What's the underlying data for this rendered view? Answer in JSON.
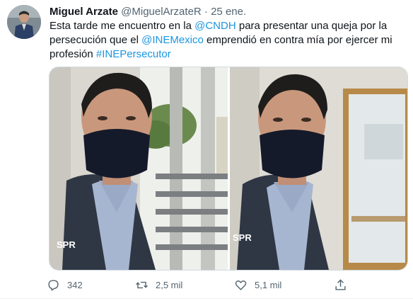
{
  "tweet": {
    "author_name": "Miguel Arzate",
    "author_handle": "@MiguelArzateR",
    "separator": "·",
    "date": "25 ene.",
    "text": {
      "part1": "Esta tarde me encuentro en la ",
      "mention1": "@CNDH",
      "part2": " para presentar una queja por la persecución que el ",
      "mention2": "@INEMexico",
      "part3": " emprendió en contra mía por ejercer mi profesión ",
      "hashtag": "#INEPersecutor"
    },
    "media": {
      "left_badge": "SPR",
      "right_badge": "SPR"
    },
    "actions": {
      "reply_count": "342",
      "retweet_count": "2,5 mil",
      "like_count": "5,1 mil"
    }
  },
  "colors": {
    "link": "#1b95e0",
    "text": "#0f1419",
    "secondary": "#536471"
  },
  "icons": [
    "reply-icon",
    "retweet-icon",
    "like-icon",
    "share-icon"
  ]
}
